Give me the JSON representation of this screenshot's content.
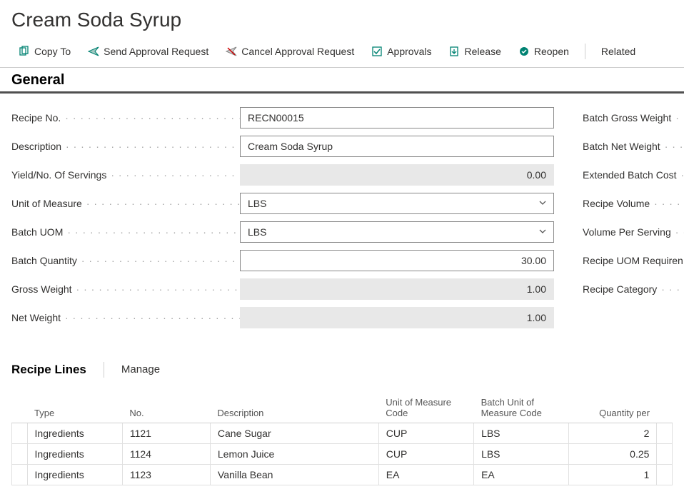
{
  "page_title": "Cream Soda Syrup",
  "toolbar": {
    "copy_to": "Copy To",
    "send_approval": "Send Approval Request",
    "cancel_approval": "Cancel Approval Request",
    "approvals": "Approvals",
    "release": "Release",
    "reopen": "Reopen",
    "related": "Related"
  },
  "sections": {
    "general": "General",
    "recipe_lines": "Recipe Lines",
    "manage": "Manage"
  },
  "general": {
    "labels": {
      "recipe_no": "Recipe No.",
      "description": "Description",
      "yield": "Yield/No. Of Servings",
      "uom": "Unit of Measure",
      "batch_uom": "Batch UOM",
      "batch_qty": "Batch Quantity",
      "gross_weight": "Gross Weight",
      "net_weight": "Net Weight",
      "batch_gross_weight": "Batch Gross Weight",
      "batch_net_weight": "Batch Net Weight",
      "extended_batch_cost": "Extended Batch Cost",
      "recipe_volume": "Recipe Volume",
      "volume_per_serving": "Volume Per Serving",
      "recipe_uom_req": "Recipe UOM Requiren",
      "recipe_category": "Recipe Category"
    },
    "values": {
      "recipe_no": "RECN00015",
      "description": "Cream Soda Syrup",
      "yield": "0.00",
      "uom": "LBS",
      "batch_uom": "LBS",
      "batch_qty": "30.00",
      "gross_weight": "1.00",
      "net_weight": "1.00"
    }
  },
  "lines": {
    "headers": {
      "type": "Type",
      "no": "No.",
      "description": "Description",
      "uom_code": "Unit of Measure Code",
      "batch_uom_code": "Batch Unit of Measure Code",
      "qty_per": "Quantity per"
    },
    "rows": [
      {
        "type": "Ingredients",
        "no": "1121",
        "description": "Cane Sugar",
        "uom": "CUP",
        "batch_uom": "LBS",
        "qty_per": "2"
      },
      {
        "type": "Ingredients",
        "no": "1124",
        "description": "Lemon Juice",
        "uom": "CUP",
        "batch_uom": "LBS",
        "qty_per": "0.25"
      },
      {
        "type": "Ingredients",
        "no": "1123",
        "description": "Vanilla Bean",
        "uom": "EA",
        "batch_uom": "EA",
        "qty_per": "1"
      }
    ]
  }
}
